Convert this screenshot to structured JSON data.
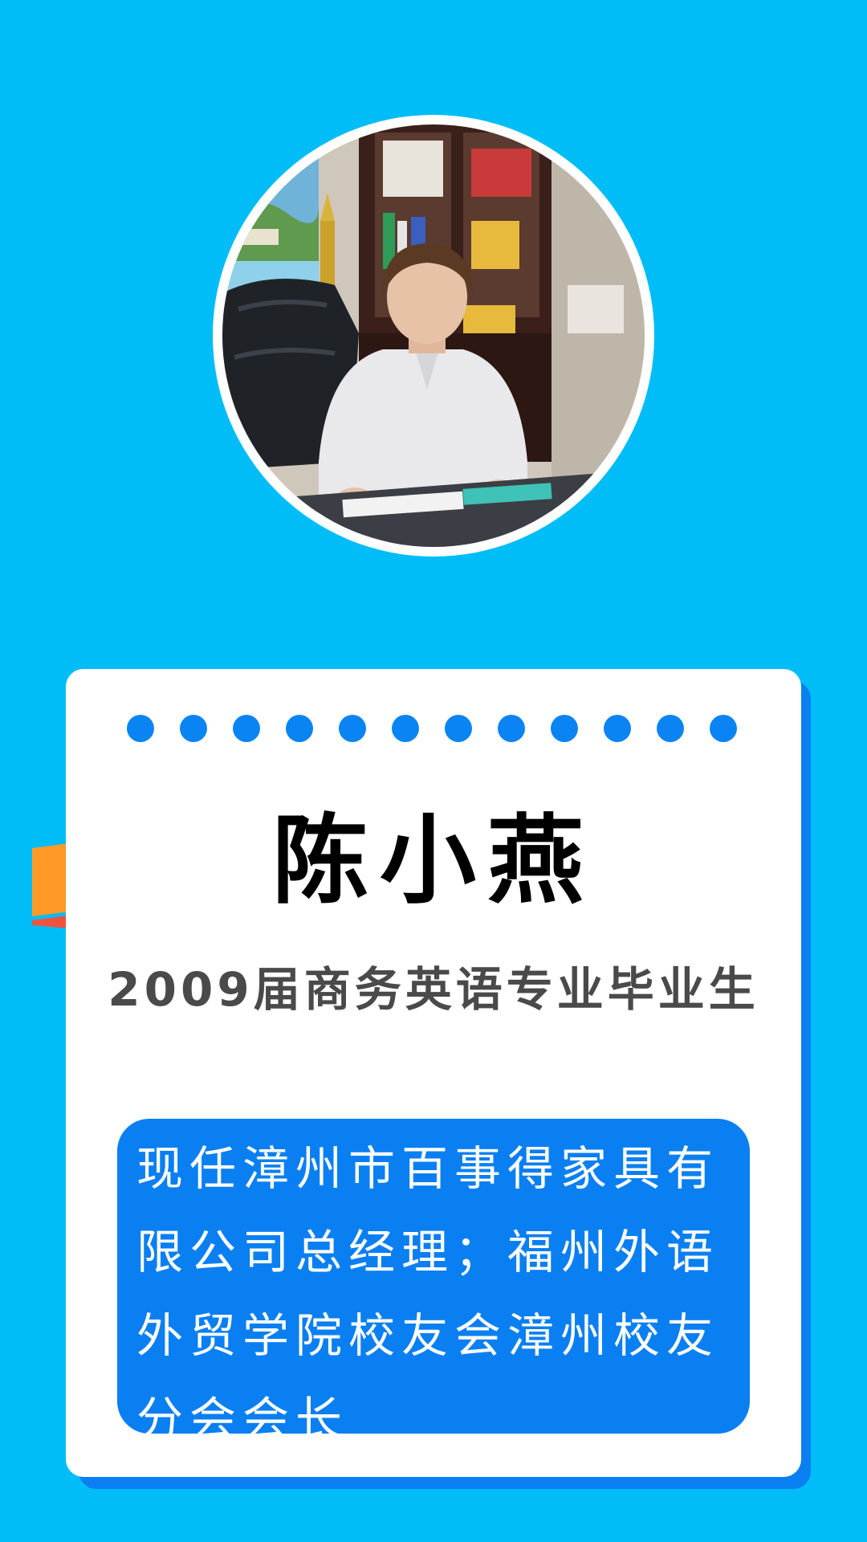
{
  "profile": {
    "photo_alt": "person seated at office desk",
    "name": "陈小燕",
    "subtitle": "2009届商务英语专业毕业生",
    "description": "现任漳州市百事得家具有限公司总经理；福州外语外贸学院校友会漳州校友分会会长"
  },
  "decor": {
    "dot_count": 12,
    "dot_color": "#0a84f3",
    "accent_blue": "#0a7ff2",
    "background": "#00bdf7",
    "ribbon_colors": [
      "#ff8a1e",
      "#ffb03a",
      "#f0533d"
    ]
  }
}
